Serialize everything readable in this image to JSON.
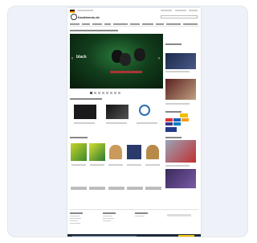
{
  "site": {
    "logo_text": "tischtennis.de"
  },
  "hero": {
    "headline": "black"
  },
  "colors": {
    "card_bg": "#eef2f8",
    "hero_green": "#123e1c",
    "cookie_bar": "#1d2a3a",
    "cookie_button": "#f0c000"
  },
  "slider": {
    "active_index": 0,
    "count": 8
  },
  "icons": {
    "flag": "de-flag-icon",
    "logo": "tt-logo-icon"
  }
}
